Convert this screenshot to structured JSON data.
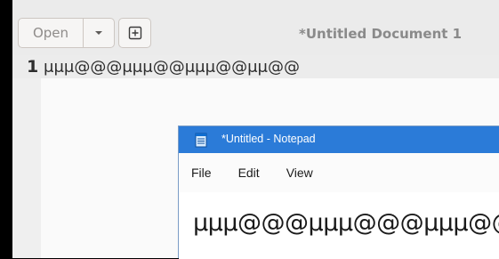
{
  "gedit": {
    "open_label": "Open",
    "title": "*Untitled Document 1",
    "line_number": "1",
    "line_text": "μμμ@@@μμμ@@μμμ@@μμ@@"
  },
  "notepad": {
    "title": "*Untitled - Notepad",
    "menu": [
      "File",
      "Edit",
      "View"
    ],
    "content": "μμμ@@@μμμ@@@μμμ@@"
  },
  "colors": {
    "notepad_titlebar": "#2b7bd8",
    "gedit_header": "#ebebeb"
  }
}
